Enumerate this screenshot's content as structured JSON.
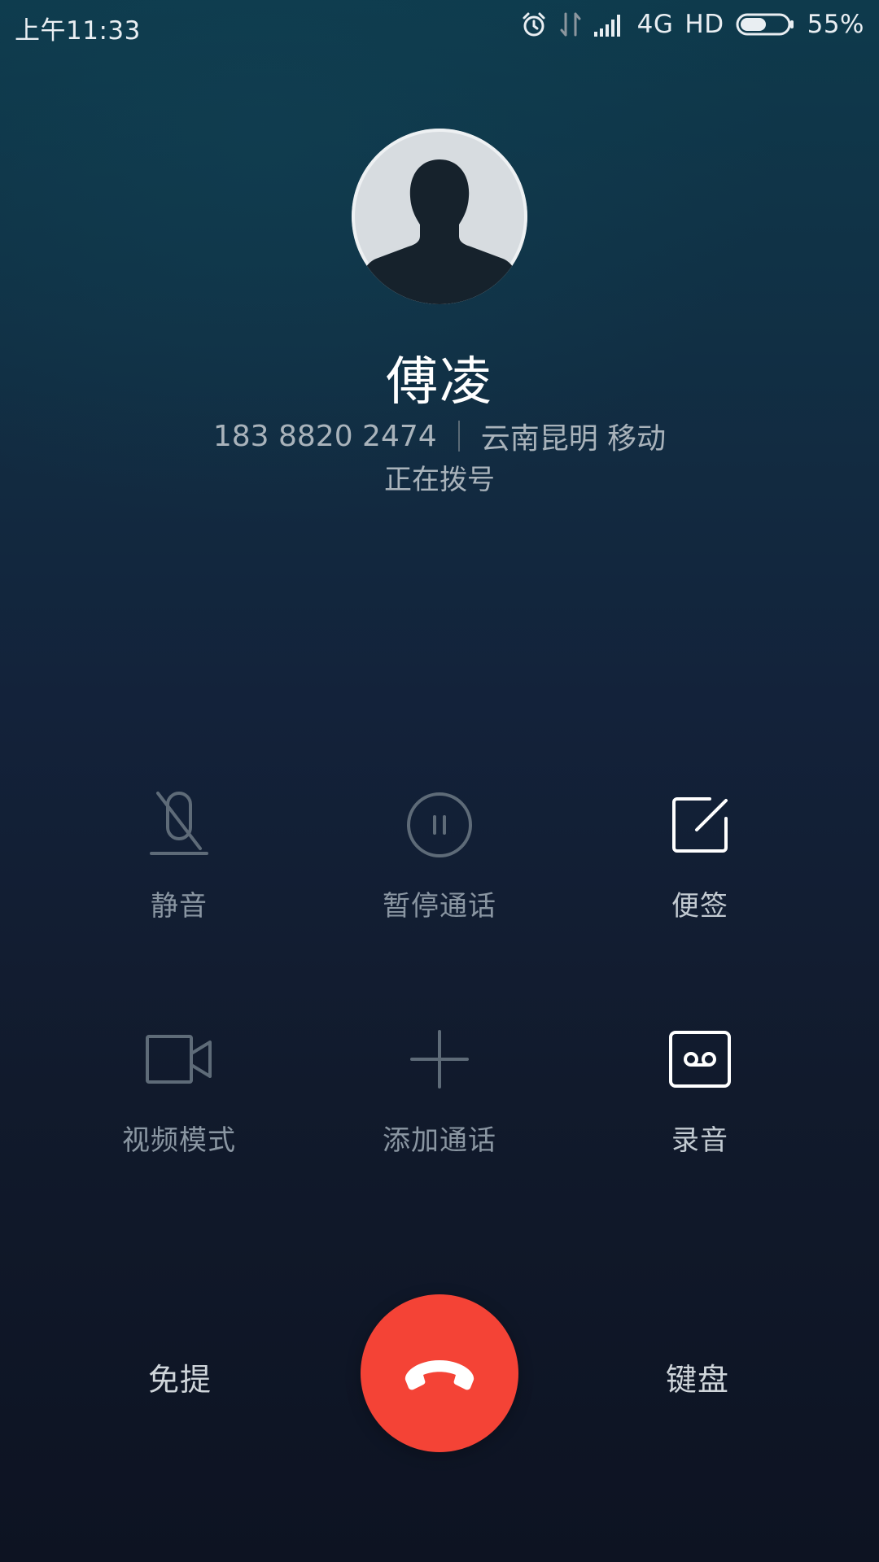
{
  "status_bar": {
    "time": "上午11:33",
    "network": "4G",
    "hd": "HD",
    "battery": "55%",
    "battery_level": 0.55,
    "icons": [
      "alarm-icon",
      "data-transfer-icon",
      "signal-icon",
      "battery-icon"
    ]
  },
  "contact": {
    "name": "傅凌",
    "number": "183 8820 2474",
    "location": "云南昆明 移动",
    "status": "正在拨号"
  },
  "actions": [
    {
      "label": "静音",
      "icon": "mute-microphone-icon",
      "enabled": false
    },
    {
      "label": "暂停通话",
      "icon": "pause-icon",
      "enabled": false
    },
    {
      "label": "便签",
      "icon": "note-icon",
      "enabled": true
    },
    {
      "label": "视频模式",
      "icon": "video-camera-icon",
      "enabled": false
    },
    {
      "label": "添加通话",
      "icon": "add-call-icon",
      "enabled": false
    },
    {
      "label": "录音",
      "icon": "record-icon",
      "enabled": true
    }
  ],
  "bottom": {
    "speaker_label": "免提",
    "keypad_label": "键盘",
    "end_call_icon": "hang-up-icon"
  },
  "colors": {
    "end_call": "#f44336",
    "disabled_icon": "#5e6b78",
    "enabled_icon": "#ffffff"
  }
}
